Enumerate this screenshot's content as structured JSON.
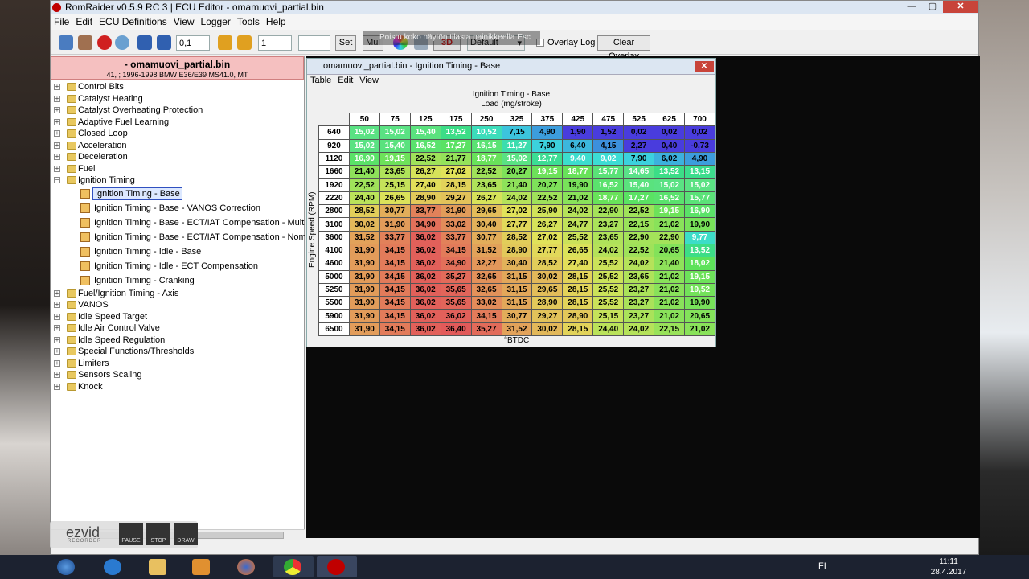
{
  "window": {
    "title": "RomRaider v0.5.9 RC 3 | ECU Editor - omamuovi_partial.bin"
  },
  "window_controls": {
    "minimize": "—",
    "maximize": "▢",
    "close": "✕"
  },
  "menu": [
    "File",
    "Edit",
    "ECU Definitions",
    "View",
    "Logger",
    "Tools",
    "Help"
  ],
  "toolbar": {
    "increment_fine": "0,1",
    "increment_coarse": "1",
    "set_value": "",
    "set_label": "Set",
    "mul_label": "Mul",
    "view_3d": "3D",
    "overlay_select": "Default",
    "overlay_log_label": "Overlay Log",
    "clear_overlay_label": "Clear Overlay",
    "overlay_hint": "Poistu koko näytön tilasta painikkeella  Esc"
  },
  "rom": {
    "file_name": "- omamuovi_partial.bin",
    "info": "41, ; 1996-1998 BMW E36/E39 MS41.0, MT"
  },
  "tree": [
    {
      "label": "Control Bits",
      "expander": "+"
    },
    {
      "label": "Catalyst Heating",
      "expander": "+"
    },
    {
      "label": "Catalyst Overheating Protection",
      "expander": "+"
    },
    {
      "label": "Adaptive Fuel Learning",
      "expander": "+"
    },
    {
      "label": "Closed Loop",
      "expander": "+"
    },
    {
      "label": "Acceleration",
      "expander": "+"
    },
    {
      "label": "Deceleration",
      "expander": "+"
    },
    {
      "label": "Fuel",
      "expander": "+"
    },
    {
      "label": "Ignition Timing",
      "expander": "−"
    }
  ],
  "tree_children": [
    {
      "label": "Ignition Timing - Base",
      "selected": true
    },
    {
      "label": "Ignition Timing - Base - VANOS Correction",
      "selected": false
    },
    {
      "label": "Ignition Timing - Base - ECT/IAT Compensation - Multiplicativ",
      "selected": false
    },
    {
      "label": "Ignition Timing - Base - ECT/IAT Compensation - Nominal",
      "selected": false
    },
    {
      "label": "Ignition Timing - Idle - Base",
      "selected": false
    },
    {
      "label": "Ignition Timing - Idle - ECT Compensation",
      "selected": false
    },
    {
      "label": "Ignition Timing - Cranking",
      "selected": false
    }
  ],
  "tree_after": [
    {
      "label": "Fuel/Ignition Timing - Axis",
      "expander": "+"
    },
    {
      "label": "VANOS",
      "expander": "+"
    },
    {
      "label": "Idle Speed Target",
      "expander": "+"
    },
    {
      "label": "Idle Air Control Valve",
      "expander": "+"
    },
    {
      "label": "Idle Speed Regulation",
      "expander": "+"
    },
    {
      "label": "Special Functions/Thresholds",
      "expander": "+"
    },
    {
      "label": "Limiters",
      "expander": "+"
    },
    {
      "label": "Sensors Scaling",
      "expander": "+"
    },
    {
      "label": "Knock",
      "expander": "+"
    }
  ],
  "table_window": {
    "title": "omamuovi_partial.bin - Ignition Timing - Base",
    "close": "✕",
    "menu": [
      "Table",
      "Edit",
      "View"
    ],
    "table_title": "Ignition Timing - Base",
    "x_axis_label": "Load (mg/stroke)",
    "y_axis_label": "Engine Speed (RPM)",
    "units": "°BTDC",
    "load_axis": [
      "50",
      "75",
      "125",
      "175",
      "250",
      "325",
      "375",
      "425",
      "475",
      "525",
      "625",
      "700"
    ],
    "rpm_axis": [
      "640",
      "920",
      "1120",
      "1660",
      "1920",
      "2220",
      "2800",
      "3100",
      "3600",
      "4100",
      "4600",
      "5000",
      "5250",
      "5500",
      "5900",
      "6500"
    ],
    "cells": [
      [
        "15,02",
        "15,02",
        "15,40",
        "13,52",
        "10,52",
        "7,15",
        "4,90",
        "1,90",
        "1,52",
        "0,02",
        "0,02",
        "0,02"
      ],
      [
        "15,02",
        "15,40",
        "16,52",
        "17,27",
        "16,15",
        "11,27",
        "7,90",
        "6,40",
        "4,15",
        "2,27",
        "0,40",
        "-0,73"
      ],
      [
        "16,90",
        "19,15",
        "22,52",
        "21,77",
        "18,77",
        "15,02",
        "12,77",
        "9,40",
        "9,02",
        "7,90",
        "6,02",
        "4,90"
      ],
      [
        "21,40",
        "23,65",
        "26,27",
        "27,02",
        "22,52",
        "20,27",
        "19,15",
        "18,77",
        "15,77",
        "14,65",
        "13,52",
        "13,15"
      ],
      [
        "22,52",
        "25,15",
        "27,40",
        "28,15",
        "23,65",
        "21,40",
        "20,27",
        "19,90",
        "16,52",
        "15,40",
        "15,02",
        "15,02"
      ],
      [
        "24,40",
        "26,65",
        "28,90",
        "29,27",
        "26,27",
        "24,02",
        "22,52",
        "21,02",
        "18,77",
        "17,27",
        "16,52",
        "15,77"
      ],
      [
        "28,52",
        "30,77",
        "33,77",
        "31,90",
        "29,65",
        "27,02",
        "25,90",
        "24,02",
        "22,90",
        "22,52",
        "19,15",
        "16,90"
      ],
      [
        "30,02",
        "31,90",
        "34,90",
        "33,02",
        "30,40",
        "27,77",
        "26,27",
        "24,77",
        "23,27",
        "22,15",
        "21,02",
        "19,90"
      ],
      [
        "31,52",
        "33,77",
        "36,02",
        "33,77",
        "30,77",
        "28,52",
        "27,02",
        "25,52",
        "23,65",
        "22,90",
        "22,90",
        "9,77"
      ],
      [
        "31,90",
        "34,15",
        "36,02",
        "34,15",
        "31,52",
        "28,90",
        "27,77",
        "26,65",
        "24,02",
        "22,52",
        "20,65",
        "13,52"
      ],
      [
        "31,90",
        "34,15",
        "36,02",
        "34,90",
        "32,27",
        "30,40",
        "28,52",
        "27,40",
        "25,52",
        "24,02",
        "21,40",
        "18,02"
      ],
      [
        "31,90",
        "34,15",
        "36,02",
        "35,27",
        "32,65",
        "31,15",
        "30,02",
        "28,15",
        "25,52",
        "23,65",
        "21,02",
        "19,15"
      ],
      [
        "31,90",
        "34,15",
        "36,02",
        "35,65",
        "32,65",
        "31,15",
        "29,65",
        "28,15",
        "25,52",
        "23,27",
        "21,02",
        "19,52"
      ],
      [
        "31,90",
        "34,15",
        "36,02",
        "35,65",
        "33,02",
        "31,15",
        "28,90",
        "28,15",
        "25,52",
        "23,27",
        "21,02",
        "19,90"
      ],
      [
        "31,90",
        "34,15",
        "36,02",
        "36,02",
        "34,15",
        "30,77",
        "29,27",
        "28,90",
        "25,15",
        "23,27",
        "21,02",
        "20,65"
      ],
      [
        "31,90",
        "34,15",
        "36,02",
        "36,40",
        "35,27",
        "31,52",
        "30,02",
        "28,15",
        "24,40",
        "24,02",
        "22,15",
        "21,02"
      ]
    ]
  },
  "ezvid": {
    "logo": "ezvid",
    "sub": "RECORDER",
    "pause": "PAUSE",
    "stop": "STOP",
    "draw": "DRAW"
  },
  "taskbar": {
    "lang": "FI",
    "time": "11:11",
    "date": "28.4.2017",
    "tasks": [
      "start-orb",
      "ie-icon",
      "explorer-icon",
      "media-player-icon",
      "firefox-icon",
      "chrome-icon",
      "romraider-icon"
    ]
  }
}
